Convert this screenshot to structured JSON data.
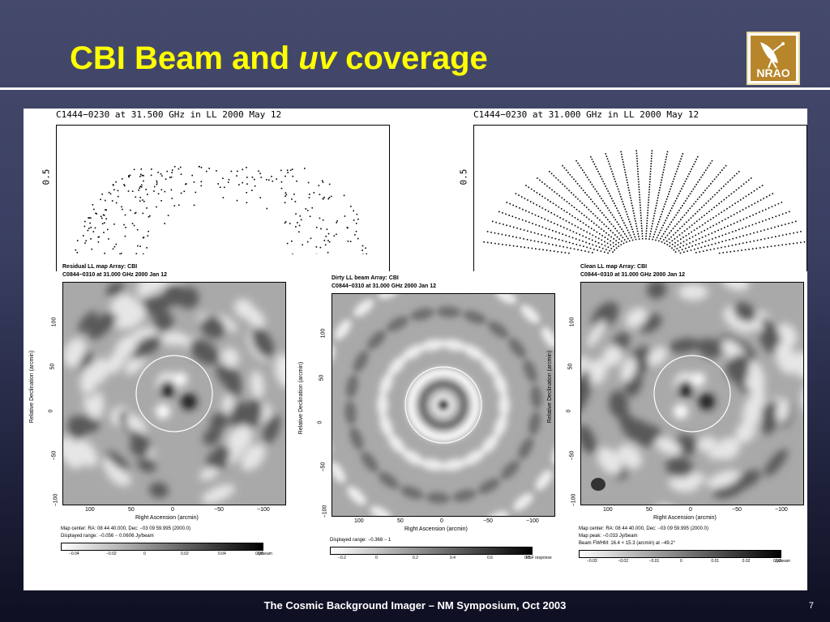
{
  "slide": {
    "title_pre": "CBI Beam and ",
    "title_italic": "uv",
    "title_post": " coverage",
    "logo_text": "NRAO",
    "footer": "The Cosmic Background Imager – NM Symposium, Oct 2003",
    "page_number": "7"
  },
  "uv_plots": [
    {
      "title": "C1444−0230 at 31.500 GHz in LL  2000 May 12",
      "ytick": "0.5"
    },
    {
      "title": "C1444−0230 at 31.000 GHz in LL  2000 May 12",
      "ytick": "0.5"
    }
  ],
  "maps": [
    {
      "header1": "Residual LL map   Array:  CBI",
      "header2": "C0844−0310 at 31.000 GHz 2000 Jan 12",
      "ylabel": "Relative Declination  (arcmin)",
      "xlabel": "Right Ascension  (arcmin)",
      "yticks": [
        "100",
        "50",
        "0",
        "−50",
        "−100"
      ],
      "xticks": [
        "100",
        "50",
        "0",
        "−50",
        "−100"
      ],
      "info": [
        "Map center:  RA: 08 44 40.000,  Dec: −03 09 59.995 (2000.0)",
        "Displayed range: −0.056 − 0.0606 Jy/beam"
      ],
      "scale_ticks": [
        "−0.04",
        "−0.02",
        "0",
        "0.02",
        "0.04",
        "0.06"
      ],
      "scale_unit": "Jy/beam"
    },
    {
      "header1": "Dirty LL beam   Array:  CBI",
      "header2": "C0844−0310 at 31.000 GHz 2000 Jan 12",
      "ylabel": "Relative Declination  (arcmin)",
      "xlabel": "Right Ascension  (arcmin)",
      "yticks": [
        "100",
        "50",
        "0",
        "−50",
        "−100"
      ],
      "xticks": [
        "100",
        "50",
        "0",
        "−50",
        "−100"
      ],
      "info": [
        "Displayed range: −0.368 − 1"
      ],
      "scale_ticks": [
        "−0.2",
        "0",
        "0.2",
        "0.4",
        "0.6",
        "0.8"
      ],
      "scale_unit": "PSF response"
    },
    {
      "header1": "Clean LL map   Array:  CBI",
      "header2": "C0844−0310 at 31.000 GHz 2000 Jan 12",
      "ylabel": "Relative Declination  (arcmin)",
      "xlabel": "Right Ascension  (arcmin)",
      "yticks": [
        "100",
        "50",
        "0",
        "−50",
        "−100"
      ],
      "xticks": [
        "100",
        "50",
        "0",
        "−50",
        "−100"
      ],
      "info": [
        "Map center:  RA: 08 44 40.000,  Dec: −03 09 59.995 (2000.0)",
        "Map peak: −0.033 Jy/beam",
        "Beam FWHM: 16.4 × 15.3 (arcmin) at −49.2°"
      ],
      "scale_ticks": [
        "−0.03",
        "−0.02",
        "−0.01",
        "0",
        "0.01",
        "0.02",
        "0.03"
      ],
      "scale_unit": "Jy/beam"
    }
  ]
}
